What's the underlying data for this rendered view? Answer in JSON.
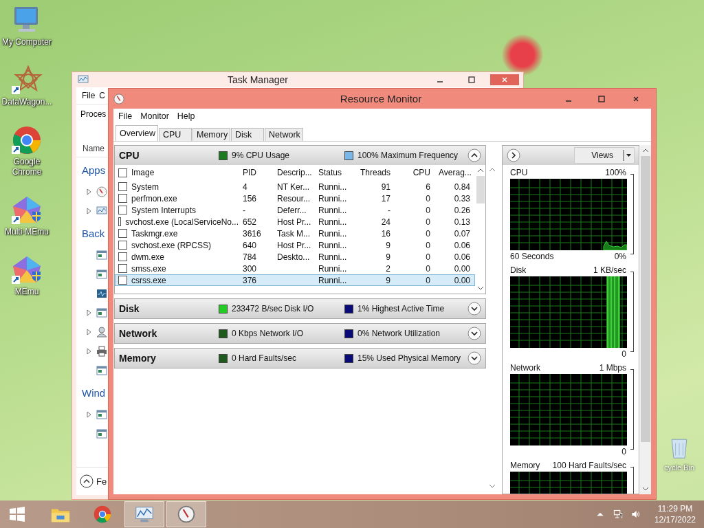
{
  "desktop_icons": [
    {
      "label": "My Computer",
      "kind": "computer"
    },
    {
      "label": "DataWagon...",
      "kind": "star"
    },
    {
      "label": "Google Chrome",
      "kind": "chrome"
    },
    {
      "label": "Multi-MEmu",
      "kind": "memu"
    },
    {
      "label": "MEmu",
      "kind": "memu"
    }
  ],
  "recycle_bin": {
    "label": "cycle Bin"
  },
  "task_manager": {
    "title": "Task Manager",
    "menu": [
      "File",
      "C"
    ],
    "tab": "Proces",
    "column": "Name",
    "rows": [
      {
        "kind": "group",
        "label": "Apps"
      },
      {
        "kind": "gauge",
        "expandable": true
      },
      {
        "kind": "chart",
        "expandable": true
      },
      {
        "kind": "group",
        "label": "Back"
      },
      {
        "kind": "window",
        "expandable": false
      },
      {
        "kind": "window",
        "expandable": false
      },
      {
        "kind": "monitor",
        "expandable": false
      },
      {
        "kind": "window",
        "expandable": true
      },
      {
        "kind": "user",
        "expandable": true
      },
      {
        "kind": "printer",
        "expandable": true
      },
      {
        "kind": "window",
        "expandable": false
      },
      {
        "kind": "group",
        "label": "Wind"
      },
      {
        "kind": "window",
        "expandable": true
      },
      {
        "kind": "window",
        "expandable": false
      }
    ],
    "footer": "Fe"
  },
  "resource_monitor": {
    "title": "Resource Monitor",
    "menu": [
      "File",
      "Monitor",
      "Help"
    ],
    "tabs": [
      {
        "label": "Overview",
        "selected": true
      },
      {
        "label": "CPU",
        "selected": false
      },
      {
        "label": "Memory",
        "selected": false
      },
      {
        "label": "Disk",
        "selected": false
      },
      {
        "label": "Network",
        "selected": false
      }
    ],
    "sections": [
      {
        "name": "CPU",
        "expanded": true,
        "indicators": [
          {
            "label": "9% CPU Usage",
            "color": "#1e7a1e"
          },
          {
            "label": "100% Maximum Frequency",
            "color": "#79b7ea"
          }
        ],
        "table": {
          "all_checked": false,
          "columns": [
            "Image",
            "PID",
            "Descrip...",
            "Status",
            "Threads",
            "CPU",
            "Averag..."
          ],
          "rows": [
            {
              "image": "System",
              "pid": "4",
              "description": "NT Ker...",
              "status": "Runni...",
              "threads": "91",
              "cpu": "6",
              "average": "0.84",
              "checked": false,
              "selected": false
            },
            {
              "image": "perfmon.exe",
              "pid": "156",
              "description": "Resour...",
              "status": "Runni...",
              "threads": "17",
              "cpu": "0",
              "average": "0.33",
              "checked": false,
              "selected": false
            },
            {
              "image": "System Interrupts",
              "pid": "-",
              "description": "Deferr...",
              "status": "Runni...",
              "threads": "-",
              "cpu": "0",
              "average": "0.26",
              "checked": false,
              "selected": false
            },
            {
              "image": "svchost.exe (LocalServiceNo...",
              "pid": "652",
              "description": "Host Pr...",
              "status": "Runni...",
              "threads": "24",
              "cpu": "0",
              "average": "0.13",
              "checked": false,
              "selected": false
            },
            {
              "image": "Taskmgr.exe",
              "pid": "3616",
              "description": "Task M...",
              "status": "Runni...",
              "threads": "16",
              "cpu": "0",
              "average": "0.07",
              "checked": false,
              "selected": false
            },
            {
              "image": "svchost.exe (RPCSS)",
              "pid": "640",
              "description": "Host Pr...",
              "status": "Runni...",
              "threads": "9",
              "cpu": "0",
              "average": "0.06",
              "checked": false,
              "selected": false
            },
            {
              "image": "dwm.exe",
              "pid": "784",
              "description": "Deskto...",
              "status": "Runni...",
              "threads": "9",
              "cpu": "0",
              "average": "0.06",
              "checked": false,
              "selected": false
            },
            {
              "image": "smss.exe",
              "pid": "300",
              "status": "Runni...",
              "threads": "2",
              "cpu": "0",
              "average": "0.00",
              "checked": false,
              "selected": false
            },
            {
              "image": "csrss.exe",
              "pid": "376",
              "status": "Runni...",
              "threads": "9",
              "cpu": "0",
              "average": "0.00",
              "checked": false,
              "selected": true
            }
          ]
        }
      },
      {
        "name": "Disk",
        "expanded": false,
        "indicators": [
          {
            "label": "233472 B/sec Disk I/O",
            "color": "#22cc22"
          },
          {
            "label": "1% Highest Active Time",
            "color": "#0a0a78"
          }
        ]
      },
      {
        "name": "Network",
        "expanded": false,
        "indicators": [
          {
            "label": "0 Kbps Network I/O",
            "color": "#1e5a1e"
          },
          {
            "label": "0% Network Utilization",
            "color": "#0a0a78"
          }
        ]
      },
      {
        "name": "Memory",
        "expanded": false,
        "indicators": [
          {
            "label": "0 Hard Faults/sec",
            "color": "#1e5a1e"
          },
          {
            "label": "15% Used Physical Memory",
            "color": "#0a0a78"
          }
        ]
      }
    ],
    "graphs_panel": {
      "views_button": "Views",
      "graphs": [
        {
          "kind": "cpu",
          "title": "CPU",
          "max": "100%",
          "time_span": "60 Seconds",
          "min": "0%"
        },
        {
          "kind": "disk",
          "title": "Disk",
          "max": "1 KB/sec",
          "min": "0"
        },
        {
          "kind": "network",
          "title": "Network",
          "max": "1 Mbps",
          "min": "0"
        },
        {
          "kind": "memory",
          "title": "Memory",
          "max": "100 Hard Faults/sec"
        }
      ]
    }
  },
  "taskbar": {
    "apps": [
      {
        "kind": "folder",
        "active": false
      },
      {
        "kind": "chrome",
        "active": false
      },
      {
        "kind": "perfmon",
        "active": true
      },
      {
        "kind": "resmon",
        "active": true
      }
    ],
    "time": "11:29 PM",
    "date": "12/17/2022"
  }
}
